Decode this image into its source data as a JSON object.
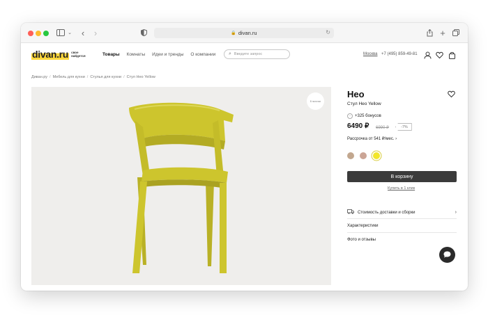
{
  "browser": {
    "url": "divan.ru"
  },
  "header": {
    "logo": "divan.ru",
    "tagline": "свое найдется",
    "nav": [
      "Товары",
      "Комнаты",
      "Идеи и тренды",
      "О компании"
    ],
    "search_placeholder": "Введите запрос",
    "city": "Москва",
    "phone": "+7 (495) 859-49-81"
  },
  "breadcrumb": [
    "Диван.ру",
    "Мебель для кухни",
    "Стулья для кухни",
    "Стул Нео Yellow"
  ],
  "gallery": {
    "badge": "В наличии"
  },
  "product": {
    "title": "Нео",
    "subtitle": "Стул Нео Yellow",
    "bonus": "+325 бонусов",
    "price": "6490 ₽",
    "old_price": "6990 ₽",
    "discount": "-7%",
    "installment": "Рассрочка от 541 ₽/мес.",
    "swatches": [
      "#c2a78f",
      "#cba596",
      "#f2e62a"
    ],
    "selected_swatch": 2,
    "cart_button": "В корзину",
    "one_click": "Купить в 1 клик",
    "rows": [
      "Стоимость доставки и сборки",
      "Характеристики",
      "Фото и отзывы"
    ]
  },
  "colors": {
    "chair": "#cdc52d",
    "logo_highlight": "#ffd83d",
    "button": "#3b3b3b"
  }
}
